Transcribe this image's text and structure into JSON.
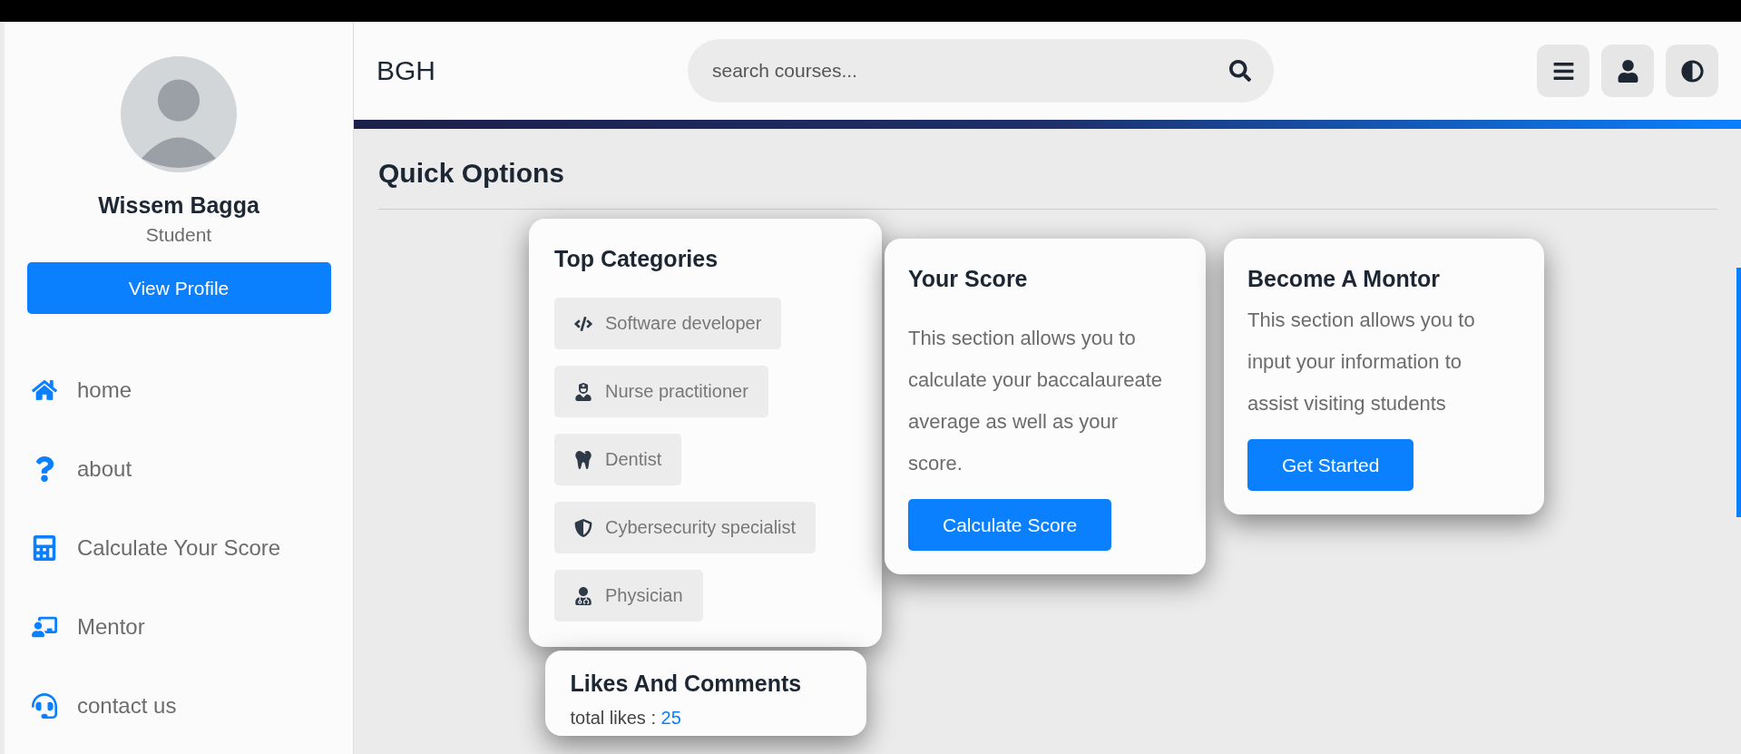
{
  "user": {
    "name": "Wissem Bagga",
    "role": "Student",
    "profile_button": "View Profile"
  },
  "nav": [
    {
      "kind": "home",
      "label": "home"
    },
    {
      "kind": "about",
      "label": "about"
    },
    {
      "kind": "calculator",
      "label": "Calculate Your Score"
    },
    {
      "kind": "mentor",
      "label": "Mentor"
    },
    {
      "kind": "contact",
      "label": "contact us"
    }
  ],
  "header": {
    "brand": "BGH",
    "search": {
      "placeholder": "search courses..."
    }
  },
  "section_title": "Quick Options",
  "categories_card": {
    "title": "Top Categories",
    "items": [
      {
        "kind": "code",
        "label": "Software developer"
      },
      {
        "kind": "nurse",
        "label": "Nurse practitioner"
      },
      {
        "kind": "tooth",
        "label": "Dentist"
      },
      {
        "kind": "shield",
        "label": "Cybersecurity specialist"
      },
      {
        "kind": "doctor",
        "label": "Physician"
      }
    ]
  },
  "score_card": {
    "title": "Your Score",
    "text": "This section allows you to calculate your baccalaureate average as well as your score.",
    "button": "Calculate Score"
  },
  "mentor_card": {
    "title": "Become A Montor",
    "text": "This section allows you to input your information to assist visiting students",
    "button": "Get Started"
  },
  "likes_card": {
    "title": "Likes And Comments",
    "likes_label": "total likes :",
    "likes_value": "25"
  }
}
